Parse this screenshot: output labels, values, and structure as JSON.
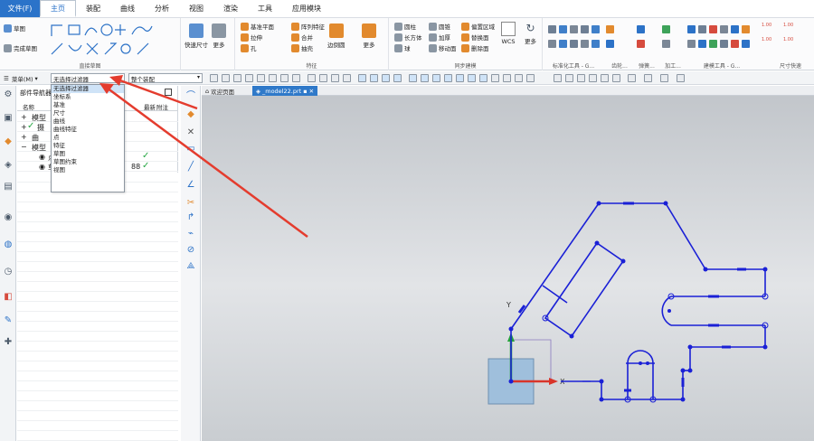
{
  "menu": {
    "file_label": "文件(F)",
    "tabs": [
      "主页",
      "装配",
      "曲线",
      "分析",
      "视图",
      "渲染",
      "工具",
      "应用模块"
    ]
  },
  "ribbon": {
    "sketch": {
      "sketch_label": "草图",
      "finish_label": "完成草图",
      "group_label": "直接草图"
    },
    "dims": {
      "quick_dim": "快速尺寸",
      "more": "更多"
    },
    "feature": {
      "datum_plane": "基准平面",
      "extrude": "拉伸",
      "hole": "孔",
      "pattern": "阵列特征",
      "unite": "合并",
      "shell": "抽壳",
      "edge_blend": "边倒圆",
      "more": "更多",
      "group_label": "特征"
    },
    "sync": {
      "cylinder": "圆柱",
      "block": "长方体",
      "sphere": "球",
      "cone": "圆锥",
      "thicken": "加厚",
      "move_face": "移动面",
      "offset_region": "偏置区域",
      "replace_face": "替换面",
      "delete_face": "删除面",
      "wcs": "WCS",
      "more": "更多",
      "group_label": "同步建模"
    },
    "std_tools": "标准化工具 - G...",
    "gear": "齿轮...",
    "spring": "弹簧...",
    "machining": "加工...",
    "modeling_tools": "建模工具 - G...",
    "dim_quick": "尺寸快速",
    "dim_labels": [
      "1.00",
      "1.00",
      "1.00",
      "1.00"
    ]
  },
  "selection_bar": {
    "menu_label": "菜单(M)",
    "filter_value": "无选择过滤器",
    "scope_value": "整个装配"
  },
  "dropdown": {
    "options": [
      "无选择过滤器",
      "坐标系",
      "基准",
      "尺寸",
      "曲线",
      "曲线特征",
      "点",
      "特征",
      "草图",
      "草图约束",
      "视图"
    ],
    "selected_index": 0
  },
  "navigator": {
    "title": "部件导航器",
    "col_name": "名称",
    "col_latest": "最新",
    "col_note": "附注",
    "rows": [
      {
        "label": "模型",
        "latest": ""
      },
      {
        "label": "摄",
        "latest": ""
      },
      {
        "label": "曲",
        "latest": ""
      },
      {
        "label": "模型",
        "latest": ""
      },
      {
        "label": "点",
        "latest": "✓"
      },
      {
        "label": "草",
        "latest": "✓"
      }
    ],
    "row_suffix": "88"
  },
  "doc_tabs": {
    "welcome": "欢迎页面",
    "model": "_model22.prt"
  },
  "viewport": {
    "axis_x": "X",
    "axis_y": "Y",
    "wire_color": "#1a20d6",
    "arrow_color": "#e43c2e"
  }
}
